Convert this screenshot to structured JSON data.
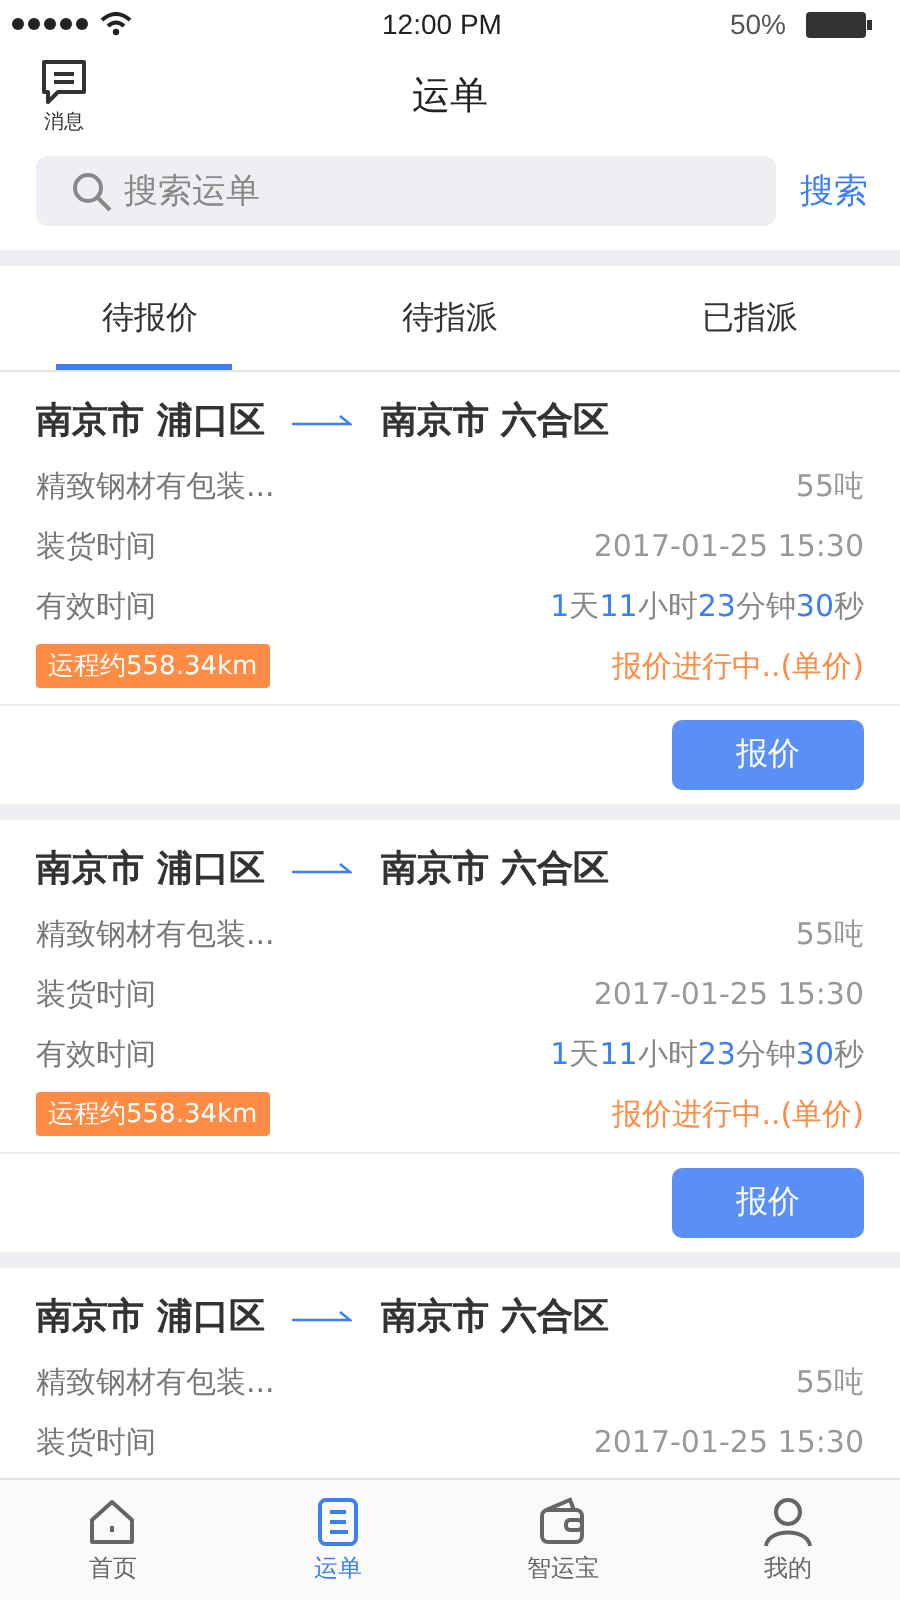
{
  "status_bar": {
    "time": "12:00 PM",
    "battery_text": "50%"
  },
  "header": {
    "message_label": "消息",
    "title": "运单"
  },
  "search": {
    "placeholder": "搜索运单",
    "button": "搜索"
  },
  "tabs": [
    {
      "label": "待报价",
      "selected": true
    },
    {
      "label": "待指派",
      "selected": false
    },
    {
      "label": "已指派",
      "selected": false
    }
  ],
  "orders": [
    {
      "origin": "南京市 浦口区",
      "destination": "南京市 六合区",
      "cargo": "精致钢材有包装...",
      "weight": "55吨",
      "load_label": "装货时间",
      "load_time": "2017-01-25  15:30",
      "valid_label": "有效时间",
      "countdown": [
        {
          "text": "1",
          "highlight": true
        },
        {
          "text": "天",
          "highlight": false
        },
        {
          "text": "11",
          "highlight": true
        },
        {
          "text": "小时",
          "highlight": false
        },
        {
          "text": "23",
          "highlight": true
        },
        {
          "text": "分钟",
          "highlight": false
        },
        {
          "text": "30",
          "highlight": true
        },
        {
          "text": "秒",
          "highlight": false
        }
      ],
      "distance": "运程约558.34km",
      "status": "报价进行中..(单价)",
      "action": "报价"
    },
    {
      "origin": "南京市 浦口区",
      "destination": "南京市 六合区",
      "cargo": "精致钢材有包装...",
      "weight": "55吨",
      "load_label": "装货时间",
      "load_time": "2017-01-25  15:30",
      "valid_label": "有效时间",
      "countdown": [
        {
          "text": "1",
          "highlight": true
        },
        {
          "text": "天",
          "highlight": false
        },
        {
          "text": "11",
          "highlight": true
        },
        {
          "text": "小时",
          "highlight": false
        },
        {
          "text": "23",
          "highlight": true
        },
        {
          "text": "分钟",
          "highlight": false
        },
        {
          "text": "30",
          "highlight": true
        },
        {
          "text": "秒",
          "highlight": false
        }
      ],
      "distance": "运程约558.34km",
      "status": "报价进行中..(单价)",
      "action": "报价"
    },
    {
      "origin": "南京市 浦口区",
      "destination": "南京市 六合区",
      "cargo": "精致钢材有包装...",
      "weight": "55吨",
      "load_label": "装货时间",
      "load_time": "2017-01-25  15:30"
    }
  ],
  "bottom_nav": [
    {
      "label": "首页",
      "kind": "home",
      "selected": false
    },
    {
      "label": "运单",
      "kind": "orders",
      "selected": true
    },
    {
      "label": "智运宝",
      "kind": "wallet",
      "selected": false
    },
    {
      "label": "我的",
      "kind": "profile",
      "selected": false
    }
  ]
}
